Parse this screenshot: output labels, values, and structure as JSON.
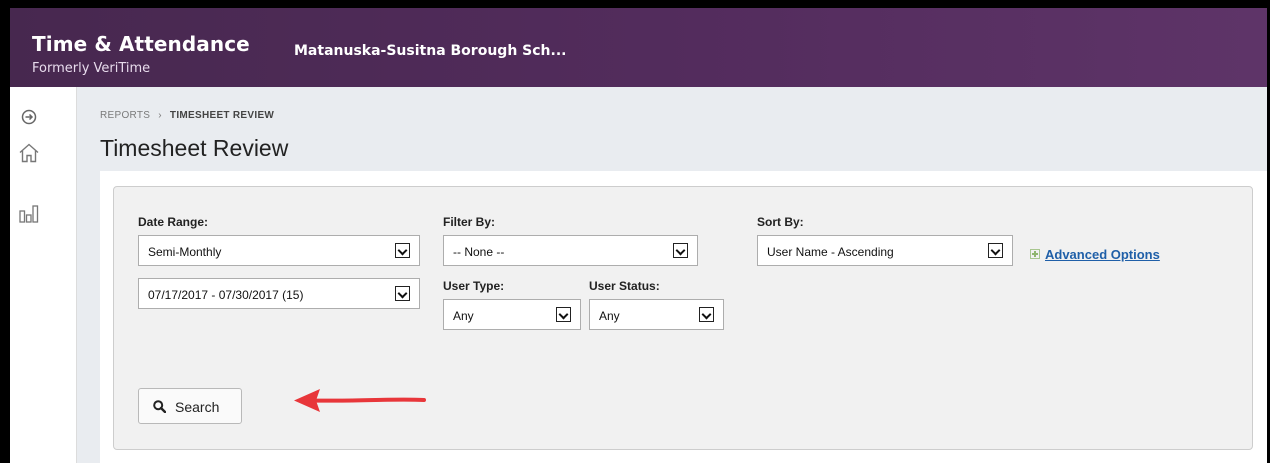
{
  "header": {
    "app_title": "Time & Attendance",
    "app_subtitle": "Formerly VeriTime",
    "organization": "Matanuska-Susitna Borough Sch..."
  },
  "breadcrumb": {
    "parent": "REPORTS",
    "separator": "›",
    "current": "TIMESHEET REVIEW"
  },
  "page_title": "Timesheet Review",
  "filters": {
    "date_range": {
      "label": "Date Range:",
      "period_value": "Semi-Monthly",
      "dates_value": "07/17/2017 - 07/30/2017 (15)"
    },
    "filter_by": {
      "label": "Filter By:",
      "value": "-- None --"
    },
    "user_type": {
      "label": "User Type:",
      "value": "Any"
    },
    "user_status": {
      "label": "User Status:",
      "value": "Any"
    },
    "sort_by": {
      "label": "Sort By:",
      "value": "User Name - Ascending"
    },
    "advanced_options": "Advanced Options",
    "search_label": "Search"
  },
  "colors": {
    "header_bg": "#532c5d",
    "link": "#1f5fa8",
    "arrow_annotation": "#e8363a"
  }
}
